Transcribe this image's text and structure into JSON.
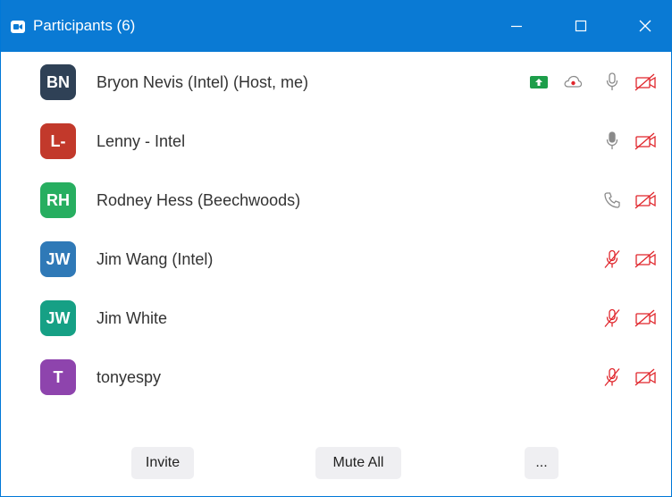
{
  "window": {
    "title": "Participants (6)",
    "accent_color": "#0a7ad4"
  },
  "participants": [
    {
      "initials": "BN",
      "name": "Bryon Nevis (Intel) (Host, me)",
      "avatar_color": "#2f4156",
      "icons": [
        "share-screen-icon",
        "cloud-record-icon",
        "mic-icon",
        "video-off-icon"
      ]
    },
    {
      "initials": "L-",
      "name": "Lenny - Intel",
      "avatar_color": "#c2392b",
      "icons": [
        "mic-icon",
        "video-off-icon"
      ]
    },
    {
      "initials": "RH",
      "name": "Rodney Hess (Beechwoods)",
      "avatar_color": "#27ae60",
      "icons": [
        "phone-icon",
        "video-off-icon"
      ]
    },
    {
      "initials": "JW",
      "name": "Jim Wang (Intel)",
      "avatar_color": "#2f79b7",
      "icons": [
        "mic-muted-icon",
        "video-off-icon"
      ]
    },
    {
      "initials": "JW",
      "name": "Jim White",
      "avatar_color": "#16a085",
      "icons": [
        "mic-muted-icon",
        "video-off-icon"
      ]
    },
    {
      "initials": "T",
      "name": "tonyespy",
      "avatar_color": "#8e44ad",
      "icons": [
        "mic-muted-icon",
        "video-off-icon"
      ]
    }
  ],
  "footer": {
    "invite_label": "Invite",
    "mute_all_label": "Mute All",
    "more_label": "..."
  }
}
